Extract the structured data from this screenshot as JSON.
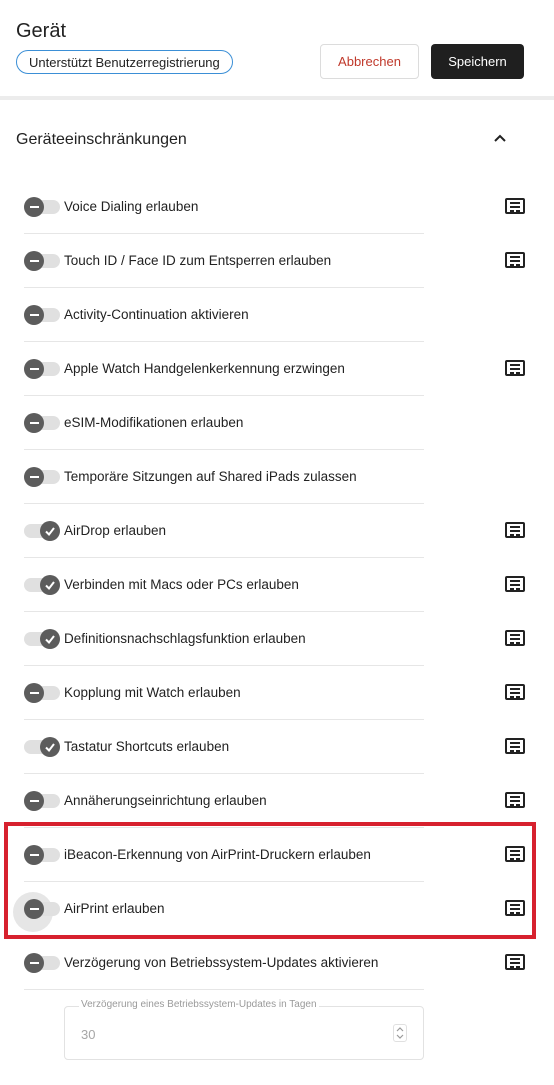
{
  "header": {
    "title": "Gerät",
    "badge": "Unterstützt Benutzerregistrierung",
    "cancel_label": "Abbrechen",
    "save_label": "Speichern"
  },
  "section": {
    "title": "Geräteeinschränkungen",
    "collapse_icon": "chevron-up-icon"
  },
  "rows": [
    {
      "label": "Voice Dialing erlauben",
      "state": "off",
      "has_doc_icon": true
    },
    {
      "label": "Touch ID / Face ID zum Entsperren erlauben",
      "state": "off",
      "has_doc_icon": true
    },
    {
      "label": "Activity-Continuation aktivieren",
      "state": "off",
      "has_doc_icon": false
    },
    {
      "label": "Apple Watch Handgelenkerkennung erzwingen",
      "state": "off",
      "has_doc_icon": true
    },
    {
      "label": "eSIM-Modifikationen erlauben",
      "state": "off",
      "has_doc_icon": false
    },
    {
      "label": "Temporäre Sitzungen auf Shared iPads zulassen",
      "state": "off",
      "has_doc_icon": false
    },
    {
      "label": "AirDrop erlauben",
      "state": "on",
      "has_doc_icon": true
    },
    {
      "label": "Verbinden mit Macs oder PCs erlauben",
      "state": "on",
      "has_doc_icon": true
    },
    {
      "label": "Definitionsnachschlagsfunktion erlauben",
      "state": "on",
      "has_doc_icon": true
    },
    {
      "label": "Kopplung mit Watch erlauben",
      "state": "off",
      "has_doc_icon": true
    },
    {
      "label": "Tastatur Shortcuts erlauben",
      "state": "on",
      "has_doc_icon": true
    },
    {
      "label": "Annäherungseinrichtung erlauben",
      "state": "off",
      "has_doc_icon": true
    },
    {
      "label": "iBeacon-Erkennung von AirPrint-Druckern erlauben",
      "state": "off",
      "has_doc_icon": true
    },
    {
      "label": "AirPrint erlauben",
      "state": "off",
      "has_doc_icon": true,
      "focused": true
    },
    {
      "label": "Verzögerung von Betriebssystem-Updates aktivieren",
      "state": "off",
      "has_doc_icon": true
    }
  ],
  "delay_field": {
    "label": "Verzögerung eines Betriebssystem-Updates in Tagen",
    "value": "30"
  },
  "colors": {
    "highlight": "#d7212e",
    "badge_border": "#3b8fd6",
    "cancel_text": "#c0392b",
    "save_bg": "#1f1f1f"
  }
}
